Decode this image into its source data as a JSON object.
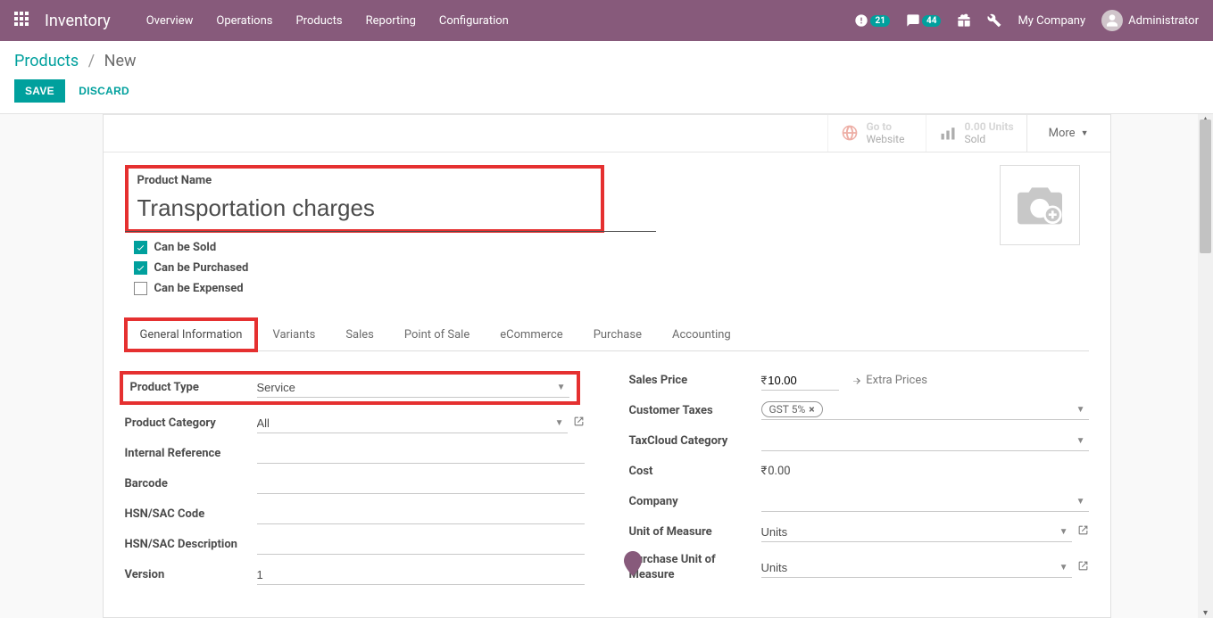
{
  "navbar": {
    "brand": "Inventory",
    "menu": [
      "Overview",
      "Operations",
      "Products",
      "Reporting",
      "Configuration"
    ],
    "activity_count": "21",
    "message_count": "44",
    "company": "My Company",
    "user": "Administrator"
  },
  "breadcrumb": {
    "parent": "Products",
    "current": "New"
  },
  "buttons": {
    "save": "SAVE",
    "discard": "DISCARD"
  },
  "stat": {
    "website_line1": "Go to",
    "website_line2": "Website",
    "units_value": "0.00 Units",
    "units_label": "Sold",
    "more": "More"
  },
  "product": {
    "name_label": "Product Name",
    "name": "Transportation charges",
    "can_be_sold_label": "Can be Sold",
    "can_be_purchased_label": "Can be Purchased",
    "can_be_expensed_label": "Can be Expensed"
  },
  "tabs": [
    "General Information",
    "Variants",
    "Sales",
    "Point of Sale",
    "eCommerce",
    "Purchase",
    "Accounting"
  ],
  "fields": {
    "product_type_label": "Product Type",
    "product_type": "Service",
    "category_label": "Product Category",
    "category": "All",
    "internal_ref_label": "Internal Reference",
    "internal_ref": "",
    "barcode_label": "Barcode",
    "barcode": "",
    "hsn_code_label": "HSN/SAC Code",
    "hsn_code": "",
    "hsn_desc_label": "HSN/SAC Description",
    "hsn_desc": "",
    "version_label": "Version",
    "version": "1",
    "sales_price_label": "Sales Price",
    "sales_price": "10.00",
    "extra_prices": "Extra Prices",
    "cust_tax_label": "Customer Taxes",
    "cust_tax": "GST 5%",
    "taxcloud_label": "TaxCloud Category",
    "taxcloud": "",
    "cost_label": "Cost",
    "cost": "0.00",
    "company_label": "Company",
    "company": "",
    "uom_label": "Unit of Measure",
    "uom": "Units",
    "puom_label": "Purchase Unit of Measure",
    "puom": "Units",
    "currency": "₹"
  }
}
